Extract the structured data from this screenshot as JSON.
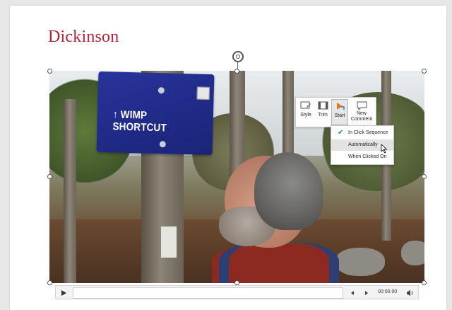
{
  "slide": {
    "logo": "Dickinson"
  },
  "photo": {
    "sign_text": "↑ WIMP SHORTCUT"
  },
  "toolbar": {
    "buttons": [
      {
        "label": "Style",
        "icon": "video-style-icon"
      },
      {
        "label": "Trim",
        "icon": "trim-video-icon"
      },
      {
        "label": "Start",
        "icon": "start-icon",
        "active": true
      },
      {
        "label": "New\nComment",
        "icon": "new-comment-icon"
      }
    ]
  },
  "start_menu": {
    "items": [
      {
        "label": "In Click Sequence",
        "checked": true
      },
      {
        "label": "Automatically",
        "hovered": true
      },
      {
        "label": "When Clicked On"
      }
    ]
  },
  "player": {
    "time": "00:00.00"
  },
  "colors": {
    "logo": "#b0253a",
    "sign_blue": "#1b2478",
    "check_green": "#2f9a3b"
  }
}
